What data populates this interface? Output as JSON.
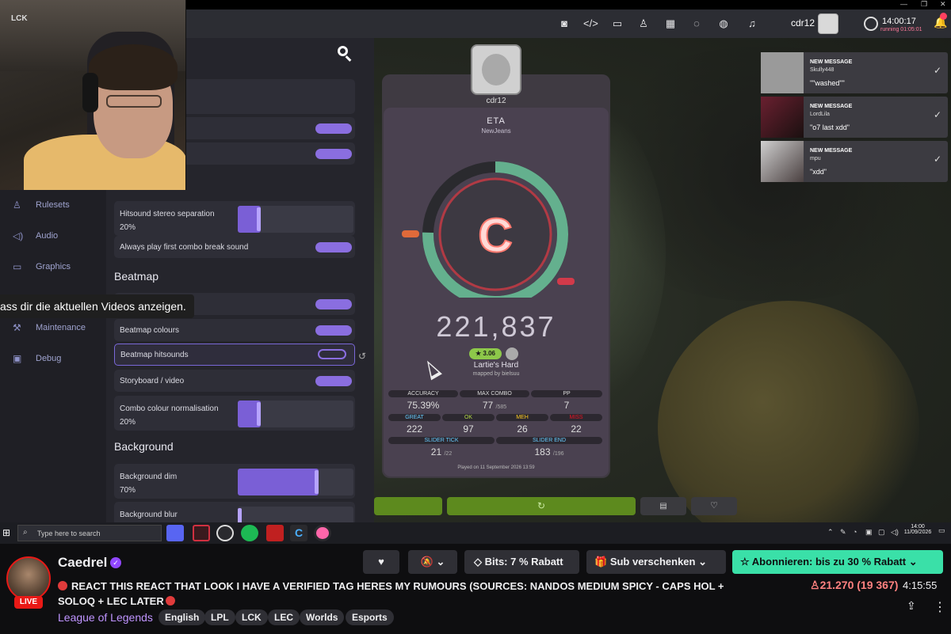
{
  "toolbar": {
    "username": "cdr12",
    "time": "14:00:17",
    "running": "running 01:05:01"
  },
  "settings": {
    "sidebar": [
      {
        "label": "Rulesets",
        "icon": "ruleset-icon"
      },
      {
        "label": "Audio",
        "icon": "speaker-icon"
      },
      {
        "label": "Graphics",
        "icon": "monitor-icon"
      },
      {
        "label": "Maintenance",
        "icon": "wrench-icon"
      },
      {
        "label": "Debug",
        "icon": "chip-icon"
      }
    ],
    "audio_rows": {
      "stereo_label": "Hitsound stereo separation",
      "stereo_value": "20%",
      "stereo_fraction": 0.2,
      "combo_break_label": "Always play first combo break sound"
    },
    "beatmap_title": "Beatmap",
    "beatmap_rows": {
      "colours": "Beatmap colours",
      "hitsounds": "Beatmap hitsounds",
      "storyboard": "Storyboard / video",
      "combo_norm_label": "Combo colour normalisation",
      "combo_norm_value": "20%",
      "combo_norm_fraction": 0.2
    },
    "background_title": "Background",
    "background_rows": {
      "dim_label": "Background dim",
      "dim_value": "70%",
      "dim_fraction": 0.7,
      "blur_label": "Background blur"
    }
  },
  "tooltip": "ass dir die aktuellen Videos anzeigen.",
  "results": {
    "username": "cdr12",
    "title": "ETA",
    "artist": "NewJeans",
    "rank": "C",
    "score": "221,837",
    "stars": "★ 3.06",
    "difficulty": "Lartie's Hard",
    "mapper": "mapped by bielsuu",
    "stats_top": [
      {
        "label": "ACCURACY",
        "value": "75.39%",
        "sub": ""
      },
      {
        "label": "MAX COMBO",
        "value": "77",
        "sub": "/585"
      },
      {
        "label": "PP",
        "value": "7",
        "sub": ""
      }
    ],
    "stats_judge": [
      {
        "label": "GREAT",
        "value": "222",
        "color": "#66ccff"
      },
      {
        "label": "OK",
        "value": "97",
        "color": "#b3d944"
      },
      {
        "label": "MEH",
        "value": "26",
        "color": "#ffcc22"
      },
      {
        "label": "MISS",
        "value": "22",
        "color": "#ed1121"
      }
    ],
    "stats_slider": [
      {
        "label": "SLIDER TICK",
        "value": "21",
        "sub": "/22"
      },
      {
        "label": "SLIDER END",
        "value": "183",
        "sub": "/196"
      }
    ],
    "played": "Played on 11 September 2026 13:59",
    "accuracy_fraction": 0.7539
  },
  "notifications": [
    {
      "title": "NEW MESSAGE",
      "user": "Skully448",
      "message": "\"\"washed\"\""
    },
    {
      "title": "NEW MESSAGE",
      "user": "LordLila",
      "message": "\"o7 last xdd\""
    },
    {
      "title": "NEW MESSAGE",
      "user": "mpu",
      "message": "\"xdd\""
    }
  ],
  "taskbar": {
    "search_placeholder": "Type here to search",
    "time": "14:00",
    "date": "11/09/2026"
  },
  "stream": {
    "channel": "Caedrel",
    "live": "LIVE",
    "title": "REACT THIS REACT THAT LOOK I HAVE A VERIFIED TAG HERES MY RUMOURS (SOURCES: NANDOS MEDIUM SPICY - CAPS HOL + SOLOQ + LEC LATER",
    "category": "League of Legends",
    "tags": [
      "English",
      "LPL",
      "LCK",
      "LEC",
      "Worlds",
      "Esports"
    ],
    "bits": "Bits: 7 % Rabatt",
    "gift": "Sub verschenken",
    "subscribe": "Abonnieren: bis zu 30 % Rabatt",
    "viewers": "21.270 (19 367)",
    "uptime": "4:15:55"
  }
}
